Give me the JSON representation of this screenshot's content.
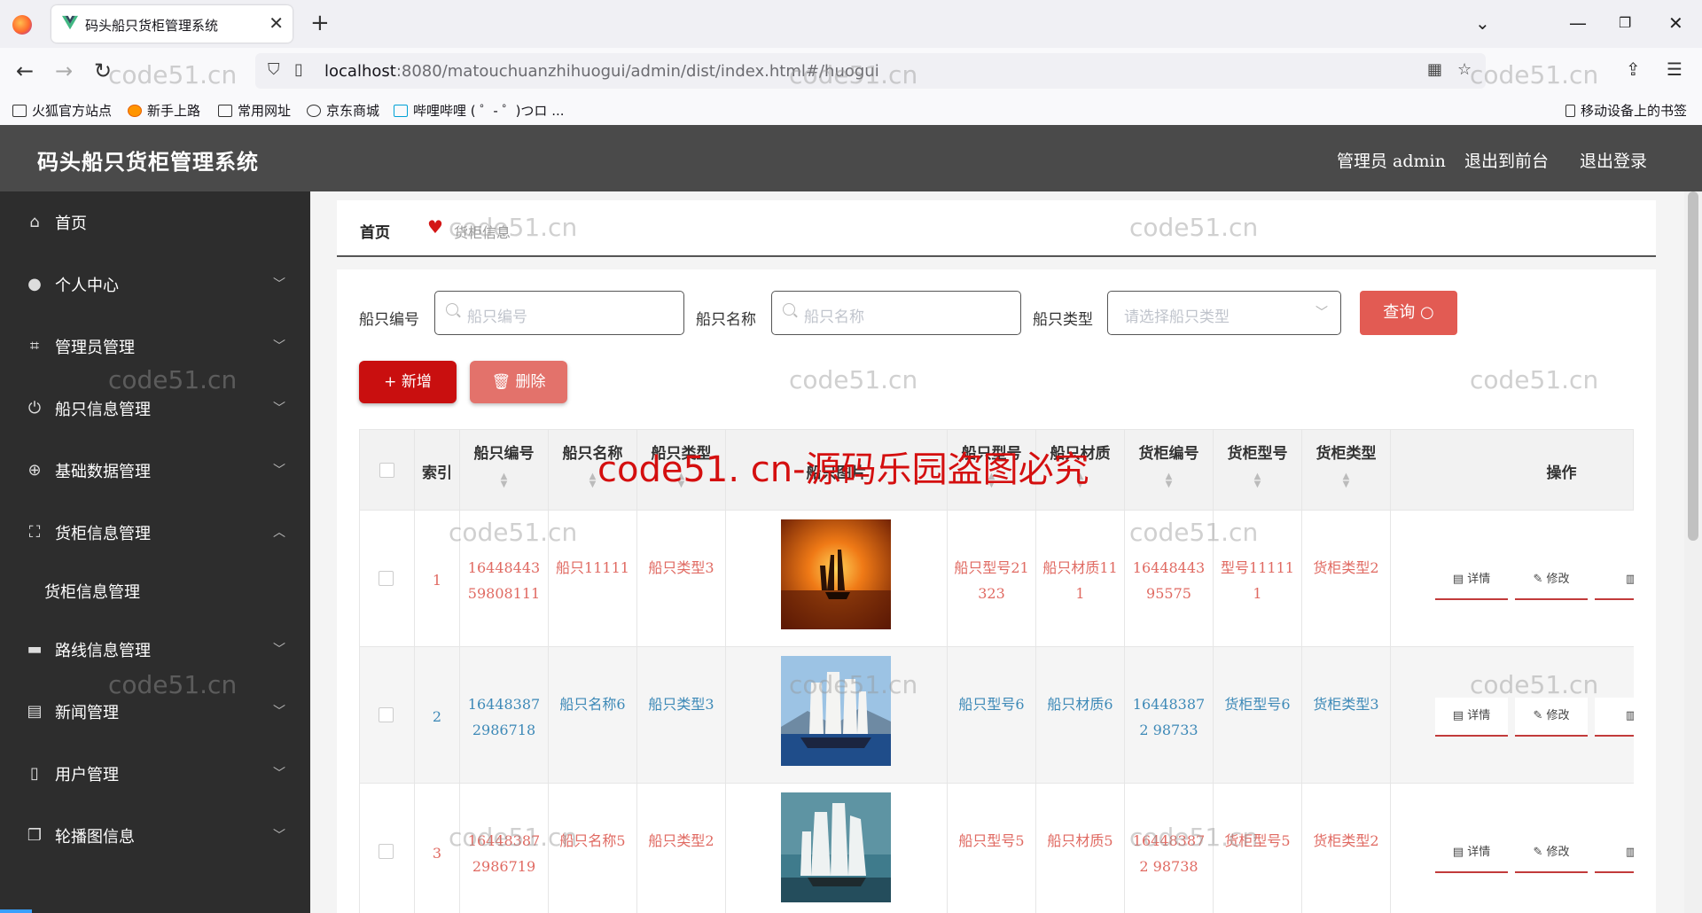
{
  "browser": {
    "tab_title": "码头船只货柜管理系统",
    "url_host": "localhost",
    "url_rest": ":8080/matouchuanzhihuogui/admin/dist/index.html#/huogui",
    "bookmarks": [
      "火狐官方站点",
      "新手上路",
      "常用网址",
      "京东商城",
      "哔哩哔哩 ( ゜- ゜)つロ ..."
    ],
    "mobile_bookmarks": "移动设备上的书签"
  },
  "header": {
    "title": "码头船只货柜管理系统",
    "admin": "管理员 admin",
    "to_front": "退出到前台",
    "logout": "退出登录"
  },
  "sidebar": {
    "items": [
      {
        "label": "首页",
        "icon": "home-icon"
      },
      {
        "label": "个人中心",
        "icon": "user-icon"
      },
      {
        "label": "管理员管理",
        "icon": "crop-icon"
      },
      {
        "label": "船只信息管理",
        "icon": "power-icon"
      },
      {
        "label": "基础数据管理",
        "icon": "globe-icon"
      },
      {
        "label": "货柜信息管理",
        "icon": "frame-icon"
      },
      {
        "label": "路线信息管理",
        "icon": "monitor-icon"
      },
      {
        "label": "新闻管理",
        "icon": "clipboard-icon"
      },
      {
        "label": "用户管理",
        "icon": "phone-icon"
      },
      {
        "label": "轮播图信息",
        "icon": "copy-icon"
      }
    ],
    "sub_item": "货柜信息管理"
  },
  "breadcrumb": {
    "home": "首页",
    "current": "货柜信息"
  },
  "filters": {
    "ship_no_label": "船只编号",
    "ship_no_placeholder": "船只编号",
    "ship_name_label": "船只名称",
    "ship_name_placeholder": "船只名称",
    "ship_type_label": "船只类型",
    "ship_type_placeholder": "请选择船只类型",
    "query": "查询"
  },
  "actions": {
    "add": "+ 新增",
    "delete": "删除"
  },
  "table": {
    "columns": [
      "索引",
      "船只编号",
      "船只名称",
      "船只类型",
      "船只图片",
      "船只型号",
      "船只材质",
      "货柜编号",
      "货柜型号",
      "货柜类型",
      "操作"
    ],
    "row_buttons": {
      "detail": "详情",
      "edit": "修改"
    },
    "rows": [
      {
        "index": "1",
        "ship_no": "1644844359808111",
        "ship_name": "船只11111",
        "ship_type": "船只类型3",
        "ship_model": "船只型号21323",
        "ship_material": "船只材质111",
        "cont_no": "1644844395575",
        "cont_model": "型号111111",
        "cont_type": "货柜类型2",
        "color": "red",
        "image": "sunset"
      },
      {
        "index": "2",
        "ship_no": "164483872986718",
        "ship_name": "船只名称6",
        "ship_type": "船只类型3",
        "ship_model": "船只型号6",
        "ship_material": "船只材质6",
        "cont_no": "164483872 98733",
        "cont_model": "货柜型号6",
        "cont_type": "货柜类型3",
        "color": "blue",
        "image": "sea"
      },
      {
        "index": "3",
        "ship_no": "164483872986719",
        "ship_name": "船只名称5",
        "ship_type": "船只类型2",
        "ship_model": "船只型号5",
        "ship_material": "船只材质5",
        "cont_no": "164483872 98738",
        "cont_model": "货柜型号5",
        "cont_type": "货柜类型2",
        "color": "red",
        "image": "cloud"
      }
    ]
  },
  "watermark": {
    "small": "code51.cn",
    "big": "code51. cn-源码乐园盗图必究"
  }
}
